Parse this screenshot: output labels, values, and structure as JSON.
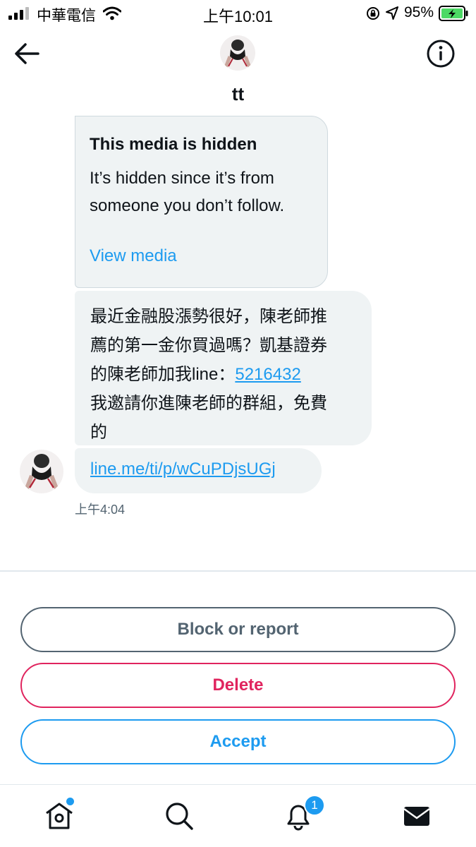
{
  "status_bar": {
    "carrier": "中華電信",
    "time": "上午10:01",
    "battery": "95%"
  },
  "header": {
    "name": "tt"
  },
  "conversation": {
    "hidden_media": {
      "title": "This media is hidden",
      "description": "It’s hidden since it’s from someone you don’t follow.",
      "link_label": "View media"
    },
    "message": {
      "line1": "最近金融股漲勢很好，陳老師推",
      "line2": "薦的第一金你買過嗎？凱基證券",
      "line3_prefix": "的陳老師加我line：",
      "phone": "5216432",
      "line4": "我邀請你進陳老師的群組，免費",
      "line5": "的"
    },
    "link_message": "line.me/ti/p/wCuPDjsUGj",
    "timestamp": "上午4:04"
  },
  "actions": {
    "block_label": "Block or report",
    "delete_label": "Delete",
    "accept_label": "Accept"
  },
  "tab_bar": {
    "notifications_badge": "1",
    "icons": [
      "home-icon",
      "search-icon",
      "bell-icon",
      "mail-icon"
    ]
  },
  "colors": {
    "accent": "#1d9bf0",
    "danger": "#e0245e",
    "muted": "#536471",
    "bubble": "#eff3f4"
  }
}
